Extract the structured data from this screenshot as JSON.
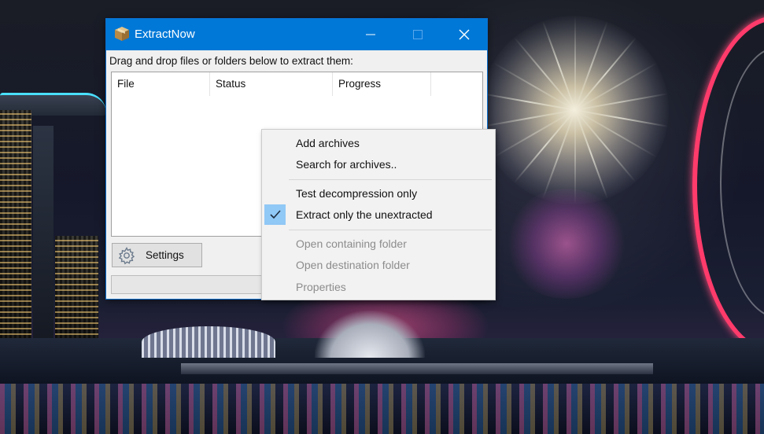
{
  "window": {
    "title": "ExtractNow",
    "instruction": "Drag and drop files or folders below to extract them:",
    "columns": [
      "File",
      "Status",
      "Progress"
    ],
    "settings_label": "Settings",
    "accent_color": "#0078d7"
  },
  "context_menu": {
    "groups": [
      [
        {
          "label": "Add archives",
          "enabled": true,
          "checked": false
        },
        {
          "label": "Search for archives..",
          "enabled": true,
          "checked": false
        }
      ],
      [
        {
          "label": "Test decompression only",
          "enabled": true,
          "checked": false
        },
        {
          "label": "Extract only the unextracted",
          "enabled": true,
          "checked": true
        }
      ],
      [
        {
          "label": "Open containing folder",
          "enabled": false,
          "checked": false
        },
        {
          "label": "Open destination folder",
          "enabled": false,
          "checked": false
        },
        {
          "label": "Properties",
          "enabled": false,
          "checked": false
        }
      ]
    ]
  }
}
